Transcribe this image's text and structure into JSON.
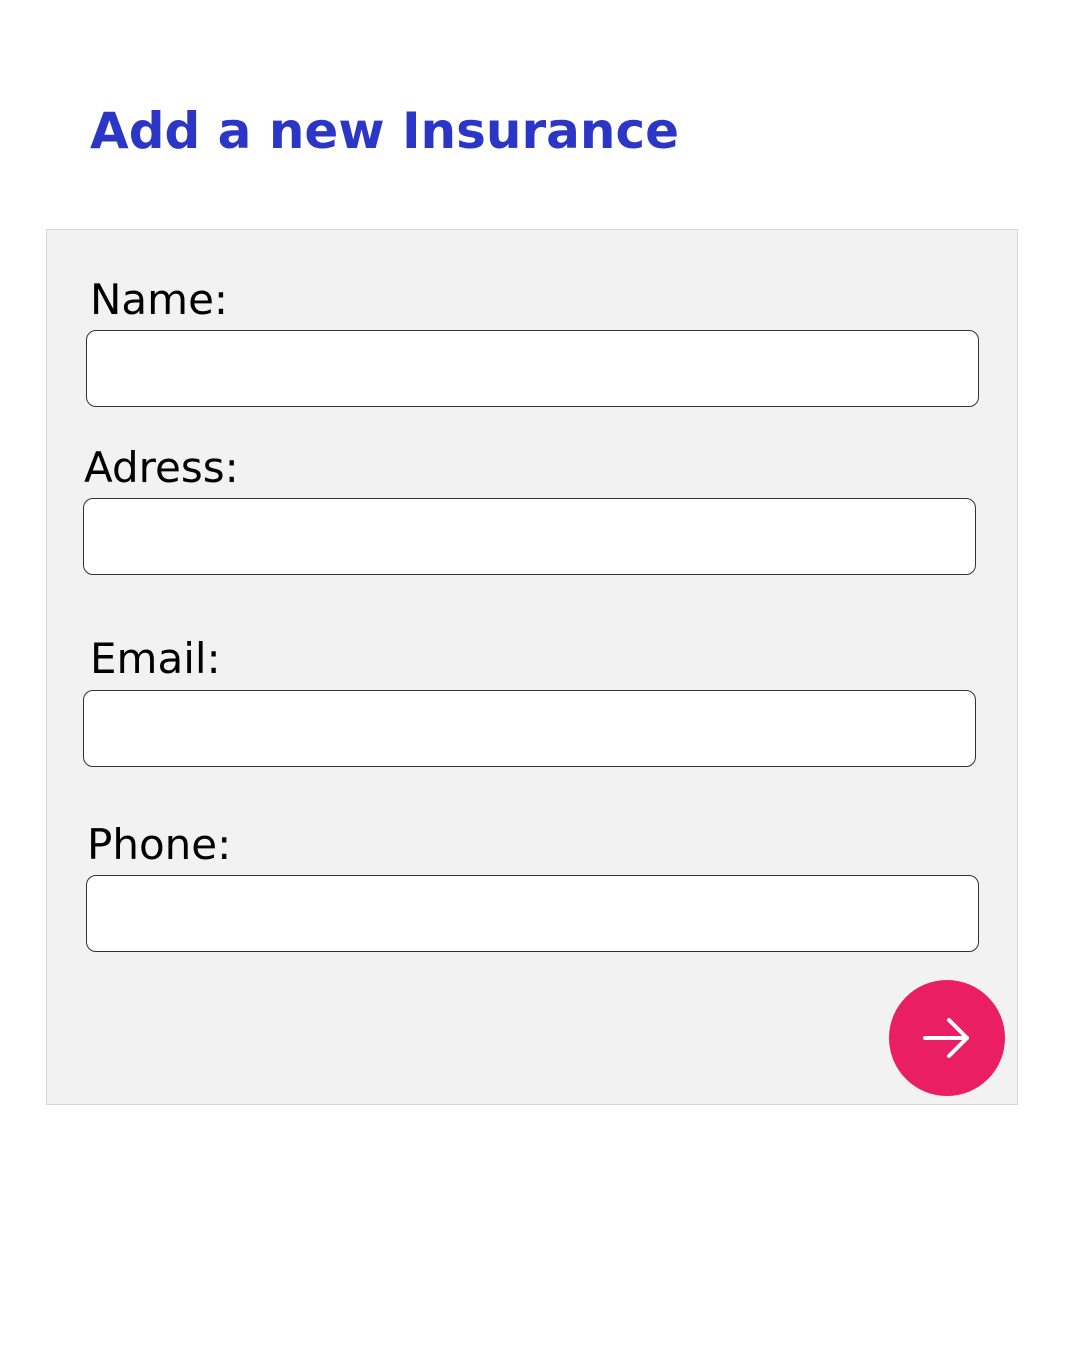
{
  "page": {
    "title": "Add a new Insurance"
  },
  "form": {
    "fields": [
      {
        "label": "Name:",
        "value": "",
        "placeholder": ""
      },
      {
        "label": "Adress:",
        "value": "",
        "placeholder": ""
      },
      {
        "label": "Email:",
        "value": "",
        "placeholder": ""
      },
      {
        "label": "Phone:",
        "value": "",
        "placeholder": ""
      }
    ],
    "submit_icon": "arrow-right-icon"
  },
  "colors": {
    "title": "#2b35c6",
    "panel_background": "#f2f2f2",
    "submit_button": "#e91e63",
    "submit_icon": "#ffffff"
  }
}
